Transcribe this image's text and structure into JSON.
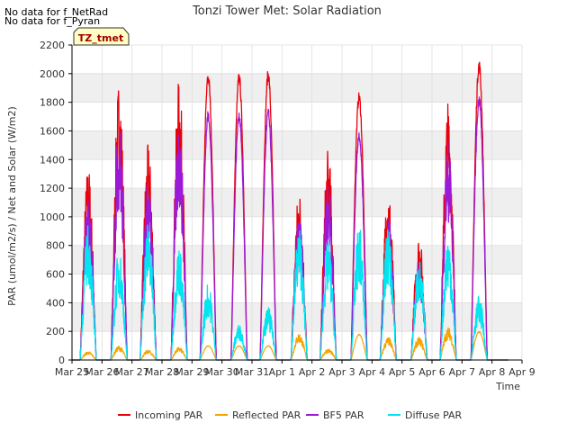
{
  "notes": [
    "No data for f_NetRad",
    "No data for f_Pyran"
  ],
  "chart_data": {
    "type": "line",
    "title": "Tonzi Tower Met: Solar Radiation",
    "xlabel": "Time",
    "ylabel": "PAR (umol/m2/s) / Net and Solar (W/m2)",
    "badge": "TZ_tmet",
    "ylim": [
      0,
      2200
    ],
    "yticks": [
      0,
      200,
      400,
      600,
      800,
      1000,
      1200,
      1400,
      1600,
      1800,
      2000,
      2200
    ],
    "xlim": [
      0,
      15
    ],
    "xticks": [
      {
        "v": 0,
        "label": "Mar 25"
      },
      {
        "v": 1,
        "label": "Mar 26"
      },
      {
        "v": 2,
        "label": "Mar 27"
      },
      {
        "v": 3,
        "label": "Mar 28"
      },
      {
        "v": 4,
        "label": "Mar 29"
      },
      {
        "v": 5,
        "label": "Mar 30"
      },
      {
        "v": 6,
        "label": "Mar 31"
      },
      {
        "v": 7,
        "label": "Apr 1"
      },
      {
        "v": 8,
        "label": "Apr 2"
      },
      {
        "v": 9,
        "label": "Apr 3"
      },
      {
        "v": 10,
        "label": "Apr 4"
      },
      {
        "v": 11,
        "label": "Apr 5"
      },
      {
        "v": 12,
        "label": "Apr 6"
      },
      {
        "v": 13,
        "label": "Apr 7"
      },
      {
        "v": 14,
        "label": "Apr 8"
      },
      {
        "v": 15,
        "label": "Apr 9"
      }
    ],
    "grid": true,
    "legend_position": "bottom",
    "series": [
      {
        "name": "Incoming PAR",
        "color": "#e8000b",
        "daily_peaks": [
          1360,
          1960,
          1510,
          1970,
          2010,
          2010,
          2030,
          1200,
          1480,
          1870,
          1220,
          880,
          1820,
          2100
        ]
      },
      {
        "name": "Reflected PAR",
        "color": "#f5a300",
        "daily_peaks": [
          60,
          100,
          70,
          90,
          100,
          100,
          100,
          190,
          80,
          180,
          160,
          160,
          230,
          200
        ]
      },
      {
        "name": "BF5 PAR",
        "color": "#9b19d8",
        "daily_peaks": [
          1160,
          1680,
          1270,
          1690,
          1740,
          1740,
          1760,
          1020,
          1270,
          1600,
          1020,
          720,
          1550,
          1850
        ]
      },
      {
        "name": "Diffuse PAR",
        "color": "#00e5f0",
        "daily_peaks": [
          950,
          780,
          980,
          800,
          540,
          250,
          370,
          940,
          840,
          950,
          940,
          710,
          880,
          450
        ]
      }
    ]
  }
}
